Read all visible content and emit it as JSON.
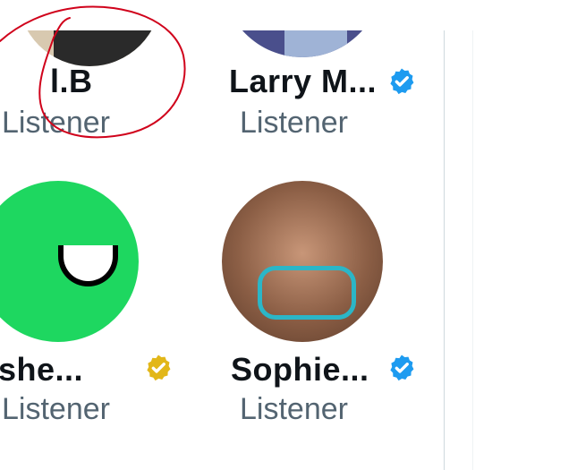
{
  "listeners": [
    {
      "name": "l.B",
      "role": "Listener",
      "verified": "none"
    },
    {
      "name": "Larry M...",
      "role": "Listener",
      "verified": "blue"
    },
    {
      "name": "she...",
      "role": "Listener",
      "verified": "gold"
    },
    {
      "name": "Sophie...",
      "role": "Listener",
      "verified": "blue"
    }
  ],
  "colors": {
    "verified_blue": "#1d9bf0",
    "verified_gold": "#e2b719",
    "name_text": "#0f1419",
    "role_text": "#536471",
    "annotation_red": "#d0021b",
    "green_avatar": "#1ed760"
  },
  "icons": {
    "blue_badge": "verified-badge-icon",
    "gold_badge": "gold-verified-badge-icon"
  }
}
